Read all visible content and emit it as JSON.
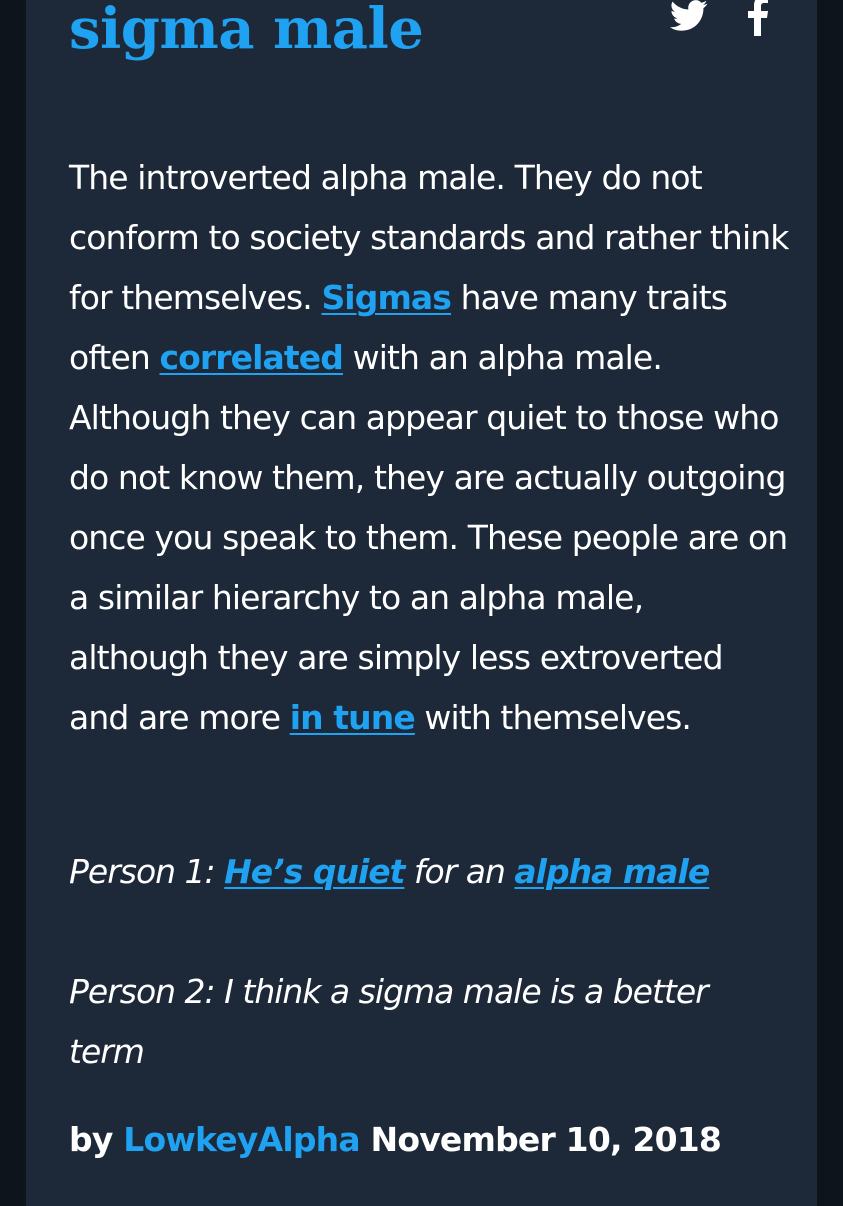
{
  "definition": {
    "word": "sigma male",
    "meaning": [
      {
        "text": "The introverted alpha male. They do not conform to society standards and rather think for themselves. "
      },
      {
        "link": "Sigmas"
      },
      {
        "text": " have many traits often "
      },
      {
        "link": "correlated"
      },
      {
        "text": " with an alpha male. Although they can appear quiet to those who do not know them, they are actually outgoing once you speak to them. These people are on a similar hierarchy to an alpha male, although they are simply less extroverted and are more "
      },
      {
        "link": "in tune"
      },
      {
        "text": " with themselves."
      }
    ],
    "example_1": [
      {
        "text": "Person 1: "
      },
      {
        "link": "He’s quiet"
      },
      {
        "text": " for an "
      },
      {
        "link": "alpha male"
      }
    ],
    "example_2": "Person 2: I think a sigma male is a better term",
    "contributor": {
      "prefix": "by",
      "author": "LowkeyAlpha",
      "date": "November 10, 2018"
    }
  },
  "share": {
    "icons": [
      "twitter-icon",
      "facebook-icon"
    ]
  },
  "colors": {
    "background": "#1d2838",
    "link": "#1fa2f1",
    "text": "#ffffff"
  }
}
